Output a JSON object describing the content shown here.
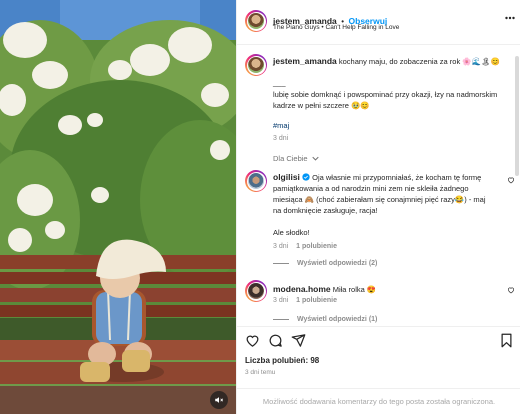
{
  "post": {
    "author": "jestem_amanda",
    "follow_label": "Obserwuj",
    "separator": "•",
    "song": "The Piano Guys • Can't Help Falling in Love"
  },
  "caption": {
    "author": "jestem_amanda",
    "line1": "kochany maju, do zobaczenia za rok 🌸🌊🏝😊",
    "dash": "___",
    "body": "lubię sobie domknąć i powspominać przy okazji, łzy na nadmorskim kadrze w pełni szczere 🥹😊",
    "hashtag": "#maj",
    "time": "3 dni"
  },
  "for_you_label": "Dla Ciebie",
  "comments": [
    {
      "author": "olgilisi",
      "verified": true,
      "text": "Oja własnie mi przypomniałaś, że kocham tę formę pamiątkowania a od narodzin mini zem nie skleiła żadnego miesiąca 🙈 (choć zabierałam się conajmniej pięć razy😂) - maj na domknięcie zasługuje, racja!",
      "text2": "Ale słodko!",
      "time": "3 dni",
      "likes": "1 polubienie",
      "replies": "Wyświetl odpowiedzi (2)"
    },
    {
      "author": "modena.home",
      "verified": false,
      "text": "Miła rolka 😍",
      "time": "3 dni",
      "likes": "1 polubienie",
      "replies": "Wyświetl odpowiedzi (1)"
    }
  ],
  "stats": {
    "likes_label": "Liczba polubień: 98",
    "time_ago": "3 dni temu"
  },
  "comment_bar": {
    "text": "Możliwość dodawania komentarzy do tego posta została ograniczona."
  },
  "icons": {
    "verified": "verified-badge-icon",
    "like": "heart-icon",
    "comment": "comment-icon",
    "share": "paper-plane-icon",
    "save": "bookmark-icon",
    "mute": "speaker-muted-icon",
    "more": "more-dots-icon"
  },
  "colors": {
    "accent": "#0095f6",
    "text": "#262626",
    "muted": "#8e8e8e"
  }
}
